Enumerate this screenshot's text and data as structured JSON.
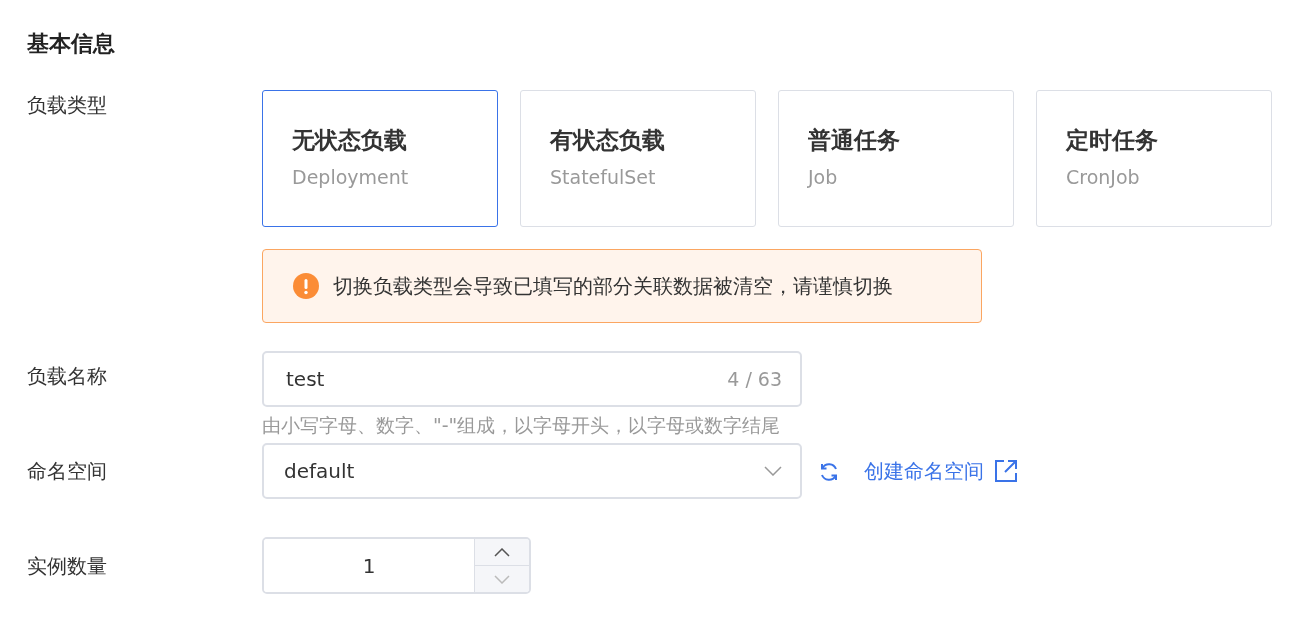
{
  "section_title": "基本信息",
  "workload_type": {
    "label": "负载类型",
    "options": [
      {
        "title": "无状态负载",
        "subtitle": "Deployment",
        "selected": true
      },
      {
        "title": "有状态负载",
        "subtitle": "StatefulSet",
        "selected": false
      },
      {
        "title": "普通任务",
        "subtitle": "Job",
        "selected": false
      },
      {
        "title": "定时任务",
        "subtitle": "CronJob",
        "selected": false
      }
    ],
    "warning": "切换负载类型会导致已填写的部分关联数据被清空，请谨慎切换"
  },
  "workload_name": {
    "label": "负载名称",
    "value": "test",
    "counter": "4 / 63",
    "hint": "由小写字母、数字、\"-\"组成，以字母开头，以字母或数字结尾"
  },
  "namespace": {
    "label": "命名空间",
    "value": "default",
    "link": "创建命名空间"
  },
  "replicas": {
    "label": "实例数量",
    "value": "1",
    "decrement_disabled": true
  }
}
